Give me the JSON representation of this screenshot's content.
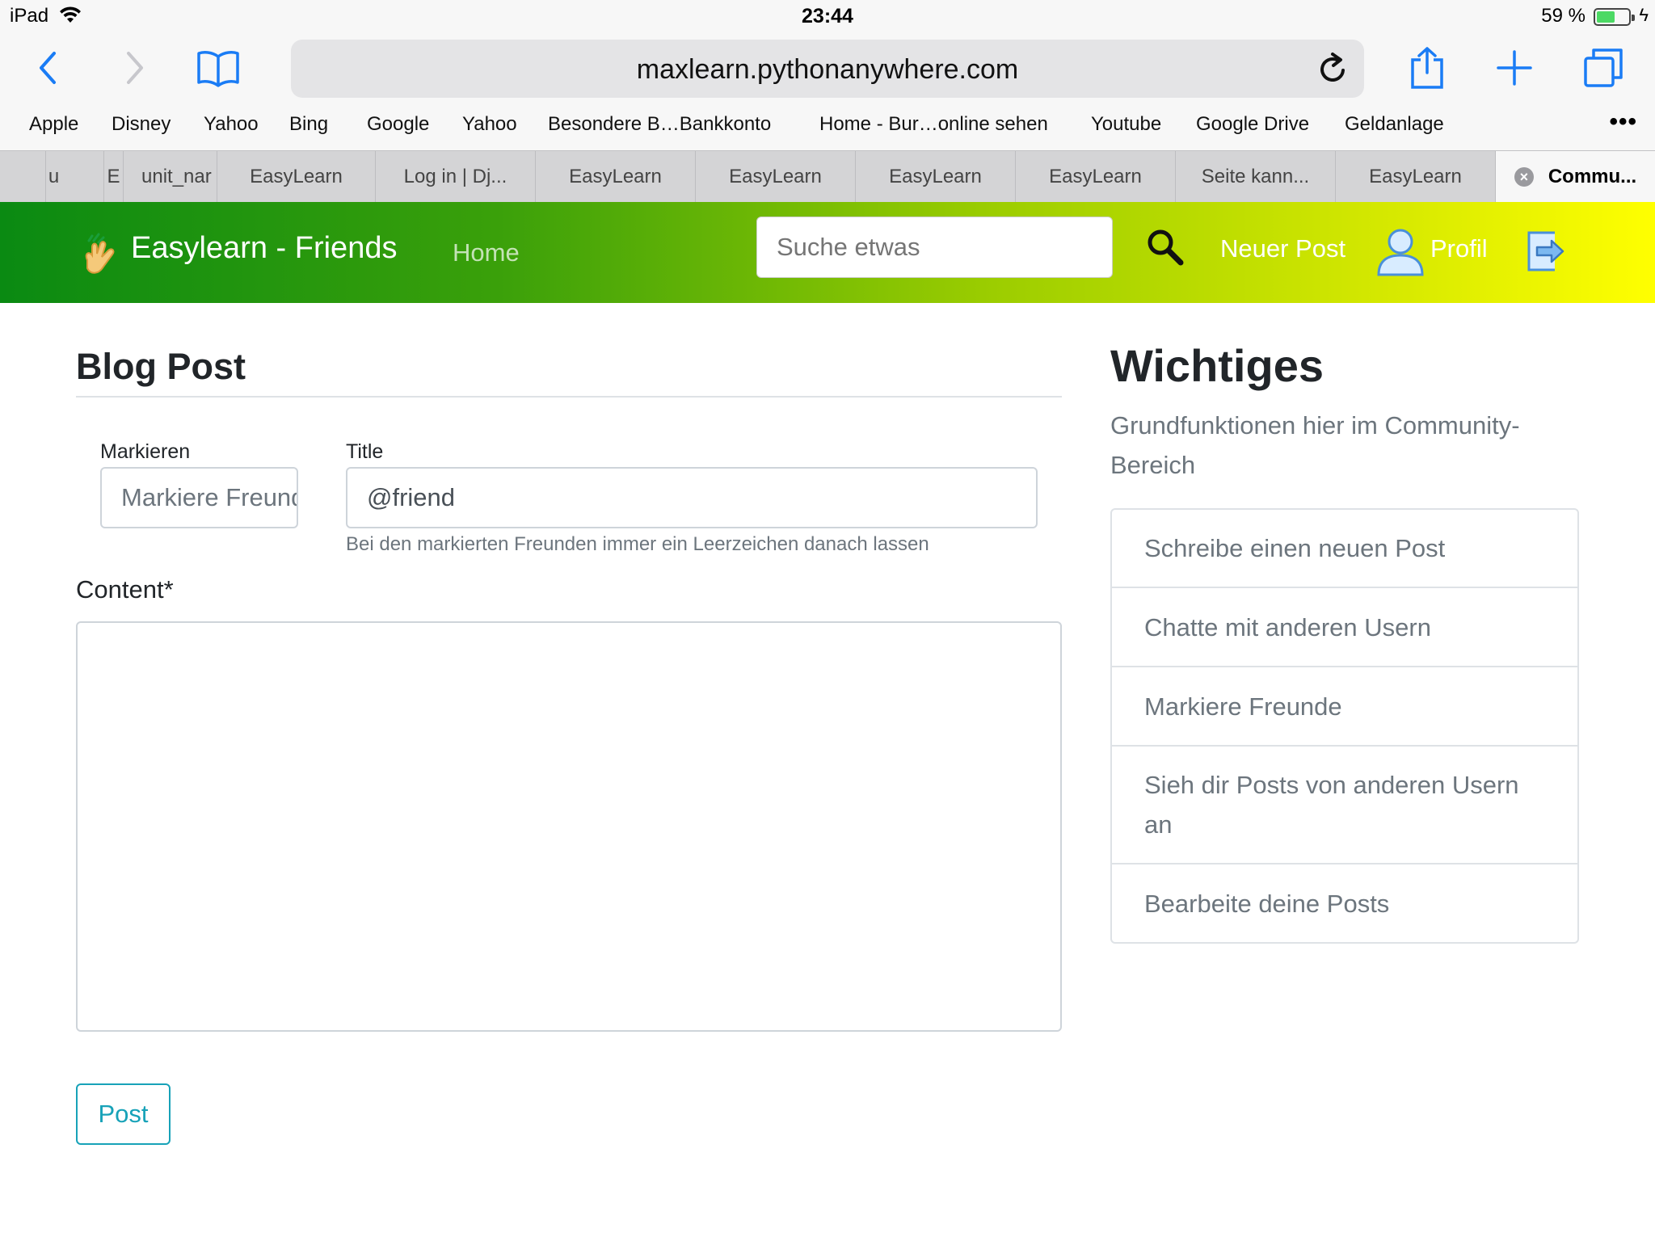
{
  "status_bar": {
    "device": "iPad",
    "time": "23:44",
    "battery_percent": "59 %",
    "battery_level": 0.59,
    "battery_color": "#4cd964"
  },
  "toolbar": {
    "url": "maxlearn.pythonanywhere.com",
    "icons": [
      "back-icon",
      "forward-icon",
      "bookmarks-icon",
      "reload-icon",
      "share-icon",
      "new-tab-icon",
      "tabs-icon"
    ]
  },
  "bookmarks": {
    "items": [
      "Apple",
      "Disney",
      "Yahoo",
      "Bing",
      "Google",
      "Yahoo",
      "Besondere B…Bankkonto",
      "Home - Bur…online sehen",
      "Youtube",
      "Google Drive",
      "Geldanlage"
    ],
    "more": "•••"
  },
  "tabs": {
    "items": [
      "u",
      "E",
      "unit_nar",
      "EasyLearn",
      "Log in | Dj...",
      "EasyLearn",
      "EasyLearn",
      "EasyLearn",
      "EasyLearn",
      "Seite kann...",
      "EasyLearn"
    ],
    "active": "Commu...",
    "close": "×"
  },
  "navbar": {
    "brand": "Easylearn - Friends",
    "home": "Home",
    "search_placeholder": "Suche etwas",
    "new_post": "Neuer Post",
    "profile": "Profil",
    "gradient_start": "#0a8a12",
    "gradient_end": "#ffff00"
  },
  "form": {
    "title": "Blog Post",
    "mark_label": "Markieren",
    "mark_placeholder": "Markiere Freunde",
    "title_label": "Title",
    "title_value": "@friend",
    "help_text": "Bei den markierten Freunden immer ein Leerzeichen danach lassen",
    "content_label": "Content*",
    "content_value": "",
    "submit": "Post",
    "accent": "#17a2b8"
  },
  "sidebar": {
    "title": "Wichtiges",
    "subtitle": "Grundfunktionen hier im Community-Bereich",
    "items": [
      "Schreibe einen neuen Post",
      "Chatte mit anderen Usern",
      "Markiere Freunde",
      "Sieh dir Posts von anderen Usern an",
      "Bearbeite deine Posts"
    ]
  }
}
